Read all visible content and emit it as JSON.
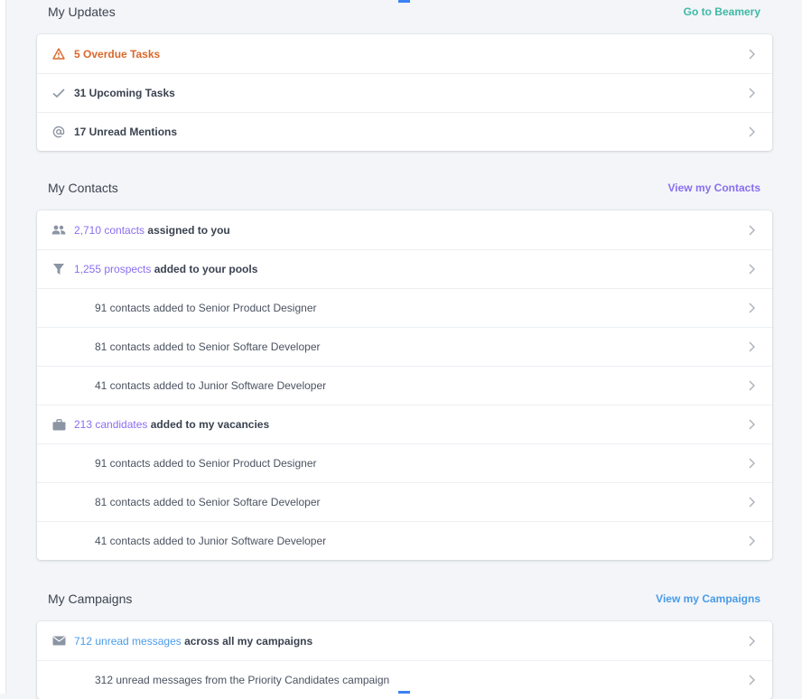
{
  "colors": {
    "accent_purple": "#8a6ef0",
    "accent_teal": "#3fb8a6",
    "accent_blue": "#4a9be8",
    "warning_orange": "#d9682b",
    "icon_gray": "#8c95a3"
  },
  "updates": {
    "title": "My Updates",
    "link": "Go to Beamery",
    "items": [
      {
        "icon": "warning-icon",
        "text": "5 Overdue Tasks"
      },
      {
        "icon": "checkmark-icon",
        "text": "31 Upcoming Tasks"
      },
      {
        "icon": "at-sign-icon",
        "text": "17 Unread Mentions"
      }
    ]
  },
  "contacts": {
    "title": "My Contacts",
    "link": "View my Contacts",
    "assigned": {
      "icon": "people-icon",
      "highlight": "2,710 contacts",
      "rest": " assigned to you"
    },
    "prospects": {
      "icon": "funnel-icon",
      "highlight": "1,255 prospects",
      "rest": " added to your pools"
    },
    "prospect_subitems": [
      "91 contacts added to Senior Product Designer",
      "81 contacts added to Senior Softare Developer",
      "41 contacts added to Junior Software Developer"
    ],
    "candidates": {
      "icon": "briefcase-icon",
      "highlight": "213 candidates",
      "rest": " added to my vacancies"
    },
    "candidate_subitems": [
      "91 contacts added to Senior Product Designer",
      "81 contacts added to Senior Softare Developer",
      "41 contacts added to Junior Software Developer"
    ]
  },
  "campaigns": {
    "title": "My Campaigns",
    "link": "View my Campaigns",
    "unread": {
      "icon": "envelope-icon",
      "highlight": "712 unread messages",
      "rest": " across all my campaigns"
    },
    "subitems": [
      "312 unread messages from the Priority Candidates campaign"
    ]
  }
}
